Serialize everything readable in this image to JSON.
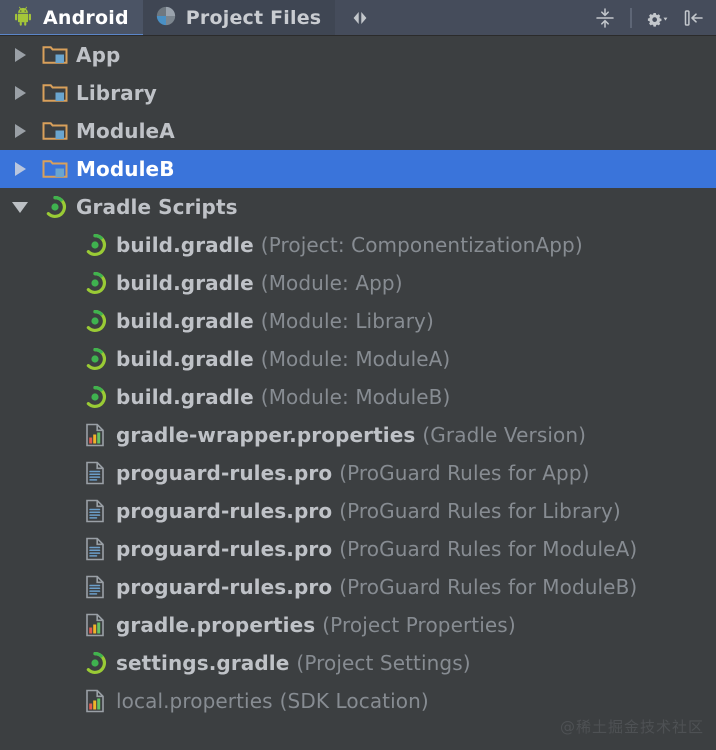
{
  "toolbar": {
    "tabs": [
      {
        "label": "Android",
        "icon": "android-robot-icon",
        "active": true
      },
      {
        "label": "Project Files",
        "icon": "pie-quadrant-icon",
        "active": false
      }
    ],
    "buttons": [
      {
        "name": "expand-collapse-icon",
        "label": ""
      },
      {
        "name": "collapse-all-icon",
        "label": ""
      },
      {
        "name": "gear-dropdown-icon",
        "label": ""
      },
      {
        "name": "hide-panel-icon",
        "label": ""
      }
    ]
  },
  "colors": {
    "background": "#3c3f41",
    "toolbar_background": "#454c5b",
    "tab_active_background": "#4b5465",
    "selection": "#3a74da",
    "label": "#bfc2c7",
    "secondary_label": "#878c92",
    "folder_icon": "#d9a05b",
    "module_marker": "#6aa5cf",
    "gradle_icon": "#9acb35",
    "gradle_icon_inner": "#3fb34f",
    "properties_icon_bars": [
      "#e05a4f",
      "#f0b429",
      "#63c363"
    ],
    "pro_icon_lines": "#6b9ec9"
  },
  "tree": [
    {
      "label": "App",
      "sub": "",
      "icon": "module-folder-icon",
      "arrow": "right",
      "indent": 1,
      "selected": false,
      "dim": false
    },
    {
      "label": "Library",
      "sub": "",
      "icon": "module-folder-icon",
      "arrow": "right",
      "indent": 1,
      "selected": false,
      "dim": false
    },
    {
      "label": "ModuleA",
      "sub": "",
      "icon": "module-folder-icon",
      "arrow": "right",
      "indent": 1,
      "selected": false,
      "dim": false
    },
    {
      "label": "ModuleB",
      "sub": "",
      "icon": "module-folder-icon",
      "arrow": "right",
      "indent": 1,
      "selected": true,
      "dim": false
    },
    {
      "label": "Gradle Scripts",
      "sub": "",
      "icon": "gradle-icon",
      "arrow": "down",
      "indent": 1,
      "selected": false,
      "dim": false
    },
    {
      "label": "build.gradle",
      "sub": "(Project: ComponentizationApp)",
      "icon": "gradle-icon",
      "arrow": "none",
      "indent": 2,
      "selected": false,
      "dim": false
    },
    {
      "label": "build.gradle",
      "sub": "(Module: App)",
      "icon": "gradle-icon",
      "arrow": "none",
      "indent": 2,
      "selected": false,
      "dim": false
    },
    {
      "label": "build.gradle",
      "sub": "(Module: Library)",
      "icon": "gradle-icon",
      "arrow": "none",
      "indent": 2,
      "selected": false,
      "dim": false
    },
    {
      "label": "build.gradle",
      "sub": "(Module: ModuleA)",
      "icon": "gradle-icon",
      "arrow": "none",
      "indent": 2,
      "selected": false,
      "dim": false
    },
    {
      "label": "build.gradle",
      "sub": "(Module: ModuleB)",
      "icon": "gradle-icon",
      "arrow": "none",
      "indent": 2,
      "selected": false,
      "dim": false
    },
    {
      "label": "gradle-wrapper.properties",
      "sub": "(Gradle Version)",
      "icon": "properties-file-icon",
      "arrow": "none",
      "indent": 2,
      "selected": false,
      "dim": false
    },
    {
      "label": "proguard-rules.pro",
      "sub": "(ProGuard Rules for App)",
      "icon": "pro-file-icon",
      "arrow": "none",
      "indent": 2,
      "selected": false,
      "dim": false
    },
    {
      "label": "proguard-rules.pro",
      "sub": "(ProGuard Rules for Library)",
      "icon": "pro-file-icon",
      "arrow": "none",
      "indent": 2,
      "selected": false,
      "dim": false
    },
    {
      "label": "proguard-rules.pro",
      "sub": "(ProGuard Rules for ModuleA)",
      "icon": "pro-file-icon",
      "arrow": "none",
      "indent": 2,
      "selected": false,
      "dim": false
    },
    {
      "label": "proguard-rules.pro",
      "sub": "(ProGuard Rules for ModuleB)",
      "icon": "pro-file-icon",
      "arrow": "none",
      "indent": 2,
      "selected": false,
      "dim": false
    },
    {
      "label": "gradle.properties",
      "sub": "(Project Properties)",
      "icon": "properties-file-icon",
      "arrow": "none",
      "indent": 2,
      "selected": false,
      "dim": false
    },
    {
      "label": "settings.gradle",
      "sub": "(Project Settings)",
      "icon": "gradle-icon",
      "arrow": "none",
      "indent": 2,
      "selected": false,
      "dim": false
    },
    {
      "label": "local.properties",
      "sub": "(SDK Location)",
      "icon": "properties-file-icon",
      "arrow": "none",
      "indent": 2,
      "selected": false,
      "dim": true
    }
  ],
  "watermark": "@稀土掘金技术社区"
}
